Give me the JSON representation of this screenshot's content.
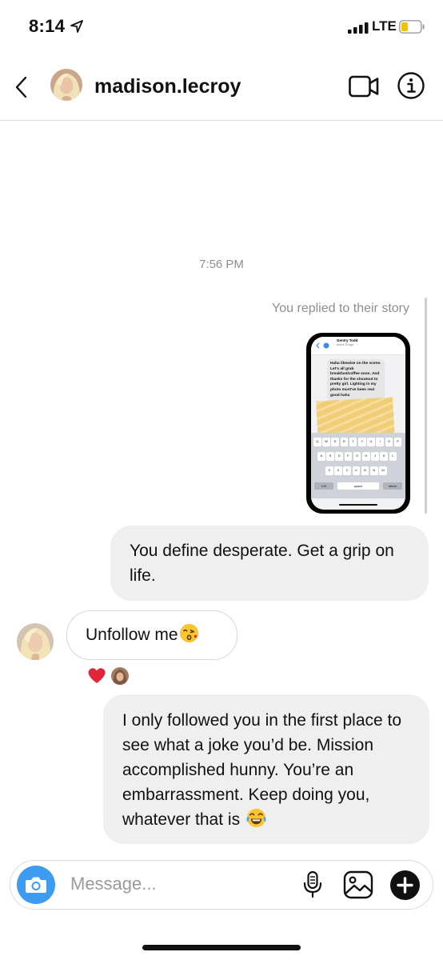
{
  "status_bar": {
    "time": "8:14",
    "network": "LTE",
    "battery_color": "#f2c200",
    "icons": [
      "location-arrow-icon",
      "signal-icon",
      "battery-icon"
    ]
  },
  "header": {
    "username": "madison.lecroy",
    "icons": [
      "back-arrow-icon",
      "video-call-icon",
      "info-icon"
    ]
  },
  "chat": {
    "timestamp": "7:56 PM",
    "story_reply_label": "You replied to their story",
    "story_preview": {
      "contact_name": "Gentry Todd",
      "contact_status": "Active 2h ago",
      "message": "Haha likewise on the scene. Let's all grab breakfast/coffee soon. And thanks for the shoutout to pretty girl. Lighting in my photo must've been real good haha",
      "keyboard_row1": [
        "Q",
        "W",
        "E",
        "R",
        "T",
        "Y",
        "U",
        "I",
        "O",
        "P"
      ],
      "keyboard_row2": [
        "A",
        "S",
        "D",
        "F",
        "G",
        "H",
        "J",
        "K",
        "L"
      ],
      "keyboard_row3": [
        "Z",
        "X",
        "C",
        "V",
        "B",
        "N",
        "M"
      ],
      "key_123": "123",
      "key_space": "space",
      "key_return": "return"
    },
    "messages": [
      {
        "from": "me",
        "text": "You define desperate. Get a grip on life."
      },
      {
        "from": "them",
        "text": "Unfollow me",
        "emoji": "kissing-face-blowing-heart-emoji",
        "reaction": "heart"
      },
      {
        "from": "me",
        "text": "I only followed you in the first place to see what a joke you’d be. Mission accomplished hunny. You’re an embarrassment. Keep doing you, whatever that is",
        "emoji": "tears-of-joy-emoji"
      }
    ],
    "accent_color": "#3d9bf0",
    "heart_color": "#e0243a"
  },
  "composer": {
    "placeholder": "Message...",
    "value": "",
    "icons": [
      "camera-icon",
      "microphone-icon",
      "gallery-icon",
      "plus-icon"
    ]
  }
}
